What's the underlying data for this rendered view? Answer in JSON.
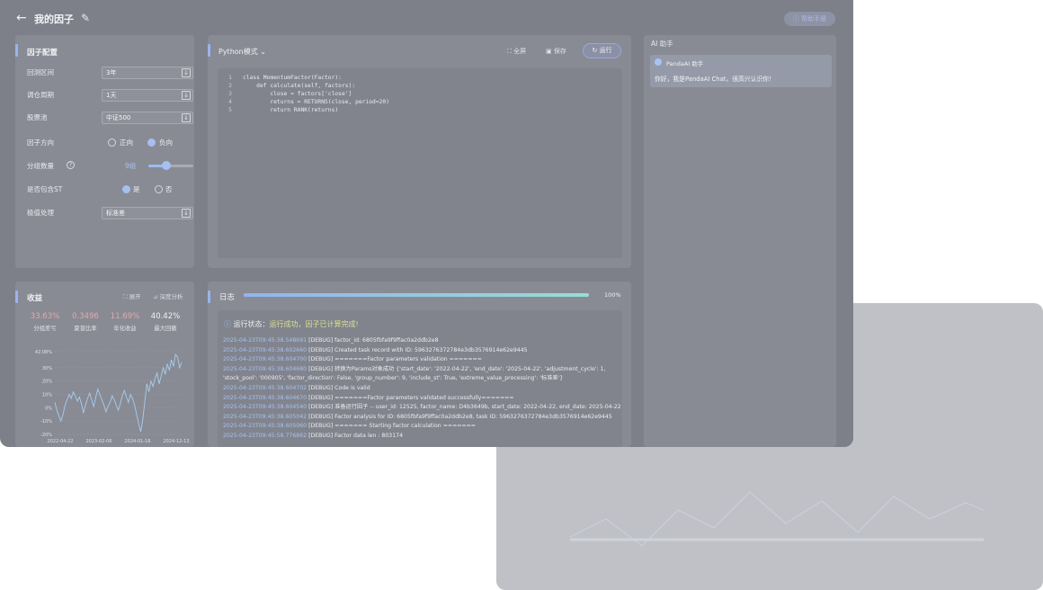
{
  "header": {
    "title": "我的因子",
    "help_label": "帮助手册"
  },
  "config": {
    "title": "因子配置",
    "rows": [
      {
        "label": "回测区间",
        "value": "3年"
      },
      {
        "label": "调仓周期",
        "value": "1天"
      },
      {
        "label": "股票池",
        "value": "中证500"
      }
    ],
    "direction": {
      "label": "因子方向",
      "options": [
        "正向",
        "负向"
      ],
      "selected": "负向"
    },
    "groups": {
      "label": "分组数量",
      "value": "9组",
      "level": 0.4
    },
    "include_st": {
      "label": "是否包含ST",
      "options": [
        "是",
        "否"
      ],
      "selected": "是"
    },
    "extreme": {
      "label": "极值处理",
      "value": "标准差"
    }
  },
  "editor": {
    "mode_label": "Python模式",
    "fullscreen_label": "全屏",
    "save_label": "保存",
    "run_label": "运行",
    "lines": [
      {
        "n": "1",
        "text": "class MomentumFactor(Factor):"
      },
      {
        "n": "2",
        "text": "    def calculate(self, factors):"
      },
      {
        "n": "3",
        "text": "        close = factors['close']"
      },
      {
        "n": "4",
        "text": "        returns = RETURNS(close, period=20)"
      },
      {
        "n": "5",
        "text": "        return RANK(returns)"
      }
    ]
  },
  "ai": {
    "title": "AI 助手",
    "assistant_name": "PandaAI 助手",
    "greeting": "你好，我是PandaAI Chat，很高兴认识你！"
  },
  "revenue": {
    "title": "收益",
    "expand_label": "展开",
    "analysis_label": "深度分析",
    "metrics": [
      {
        "value": "33.63%",
        "label": "分组差亏",
        "color": "#e8a7a7"
      },
      {
        "value": "0.3496",
        "label": "夏普比率",
        "color": "#e8a7a7"
      },
      {
        "value": "11.69%",
        "label": "年化收益",
        "color": "#e8a7a7"
      },
      {
        "value": "40.42%",
        "label": "最大回撤",
        "color": "#f2f3f6"
      }
    ]
  },
  "log": {
    "title": "日志",
    "progress": 100,
    "progress_label": "100%",
    "status_prefix": "运行状态：",
    "status_text": "运行成功，因子已计算完成!",
    "lines": [
      {
        "ts": "2025-04-23T09:45:38.548691",
        "msg": "[DEBUG] factor_id: 6805fbfa9f9ffac0a2ddb2e8"
      },
      {
        "ts": "2025-04-23T09:45:38.602660",
        "msg": "[DEBUG] Created task record with ID: 5963276372784e3db3576914e62e9445"
      },
      {
        "ts": "2025-04-23T09:45:38.604700",
        "msg": "[DEBUG] =======Factor parameters validation ======="
      },
      {
        "ts": "2025-04-23T09:45:38.604680",
        "msg": "[DEBUG] 转换为Params对象成功 {'start_date': '2022-04-22', 'end_date': '2025-04-22', 'adjustment_cycle': 1,"
      },
      {
        "ts": "",
        "msg": "'stock_pool': '000905', 'factor_direction': False, 'group_number': 9, 'include_st': True, 'extreme_value_processing': '标准差'}"
      },
      {
        "ts": "2025-04-23T09:45:38.604702",
        "msg": "[DEBUG] Code is valid"
      },
      {
        "ts": "2025-04-23T09:45:38.604670",
        "msg": "[DEBUG] =======Factor parameters validated successfully======="
      },
      {
        "ts": "2025-04-23T09:45:38.604540",
        "msg": "[DEBUG] 准备运行因子 -- user_id: 12525, factor_name: D4b3649b, start_date: 2022-04-22, end_date: 2025-04-22"
      },
      {
        "ts": "2025-04-23T09:45:38.605042",
        "msg": "[DEBUG] Factor analysis for ID: 6805fbfa9f9ffac0a2ddb2e8, task ID: 5963276372784e3db3576914e62e9445"
      },
      {
        "ts": "2025-04-23T09:45:38.605060",
        "msg": "[DEBUG] ======= Starting factor calculation ======="
      },
      {
        "ts": "2025-04-23T09:45:58.776862",
        "msg": "[DEBUG] Factor data len : 803174"
      }
    ]
  },
  "chart_data": {
    "type": "line",
    "x_ticks": [
      "2022-04-22",
      "2023-02-06",
      "2024-01-16",
      "2024-12-13"
    ],
    "y_ticks": [
      "42.08%",
      "30%",
      "20%",
      "10%",
      "0%",
      "-10%",
      "-20%"
    ],
    "ylim": [
      -20,
      42.08
    ],
    "series": [
      {
        "values": [
          4,
          -2,
          -6,
          -10,
          -5,
          2,
          6,
          10,
          7,
          12,
          9,
          5,
          8,
          3,
          -4,
          2,
          7,
          11,
          6,
          1,
          8,
          14,
          10,
          6,
          2,
          -3,
          1,
          4,
          9,
          6,
          2,
          -2,
          3,
          9,
          13,
          8,
          4,
          10,
          7,
          2,
          -5,
          -12,
          -18,
          -9,
          5,
          18,
          12,
          20,
          16,
          22,
          26,
          18,
          24,
          30,
          25,
          33,
          28,
          36,
          31,
          40,
          38,
          30,
          34
        ]
      }
    ]
  }
}
